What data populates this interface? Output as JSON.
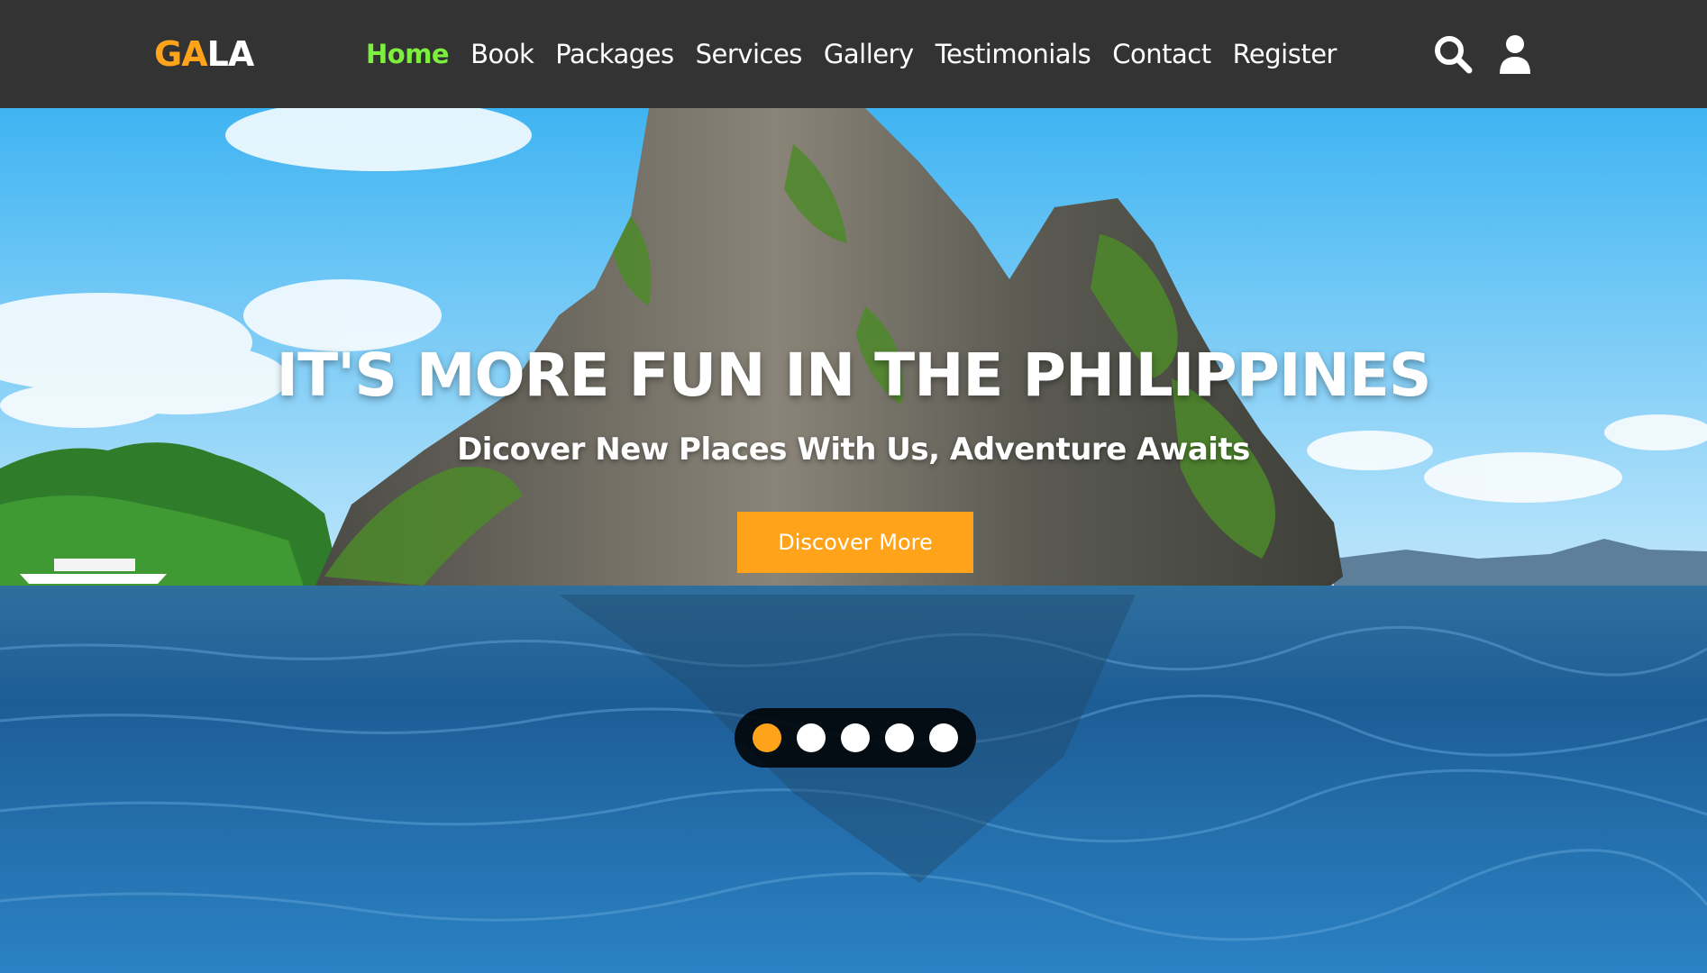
{
  "logo": {
    "part1": "GA",
    "part2": "LA"
  },
  "nav": [
    {
      "label": "Home",
      "active": true
    },
    {
      "label": "Book"
    },
    {
      "label": "Packages"
    },
    {
      "label": "Services"
    },
    {
      "label": "Gallery"
    },
    {
      "label": "Testimonials"
    },
    {
      "label": "Contact"
    },
    {
      "label": "Register"
    }
  ],
  "icons": {
    "search": "search-icon",
    "user": "user-icon"
  },
  "hero": {
    "headline": "IT'S MORE FUN IN THE PHILIPPINES",
    "subline": "Dicover New Places With Us, Adventure Awaits",
    "cta_label": "Discover More"
  },
  "slider": {
    "total": 5,
    "active_index": 0
  },
  "colors": {
    "header_bg": "#333333",
    "accent": "#ffa31a",
    "nav_active": "#7cf03d",
    "text": "#ffffff"
  }
}
